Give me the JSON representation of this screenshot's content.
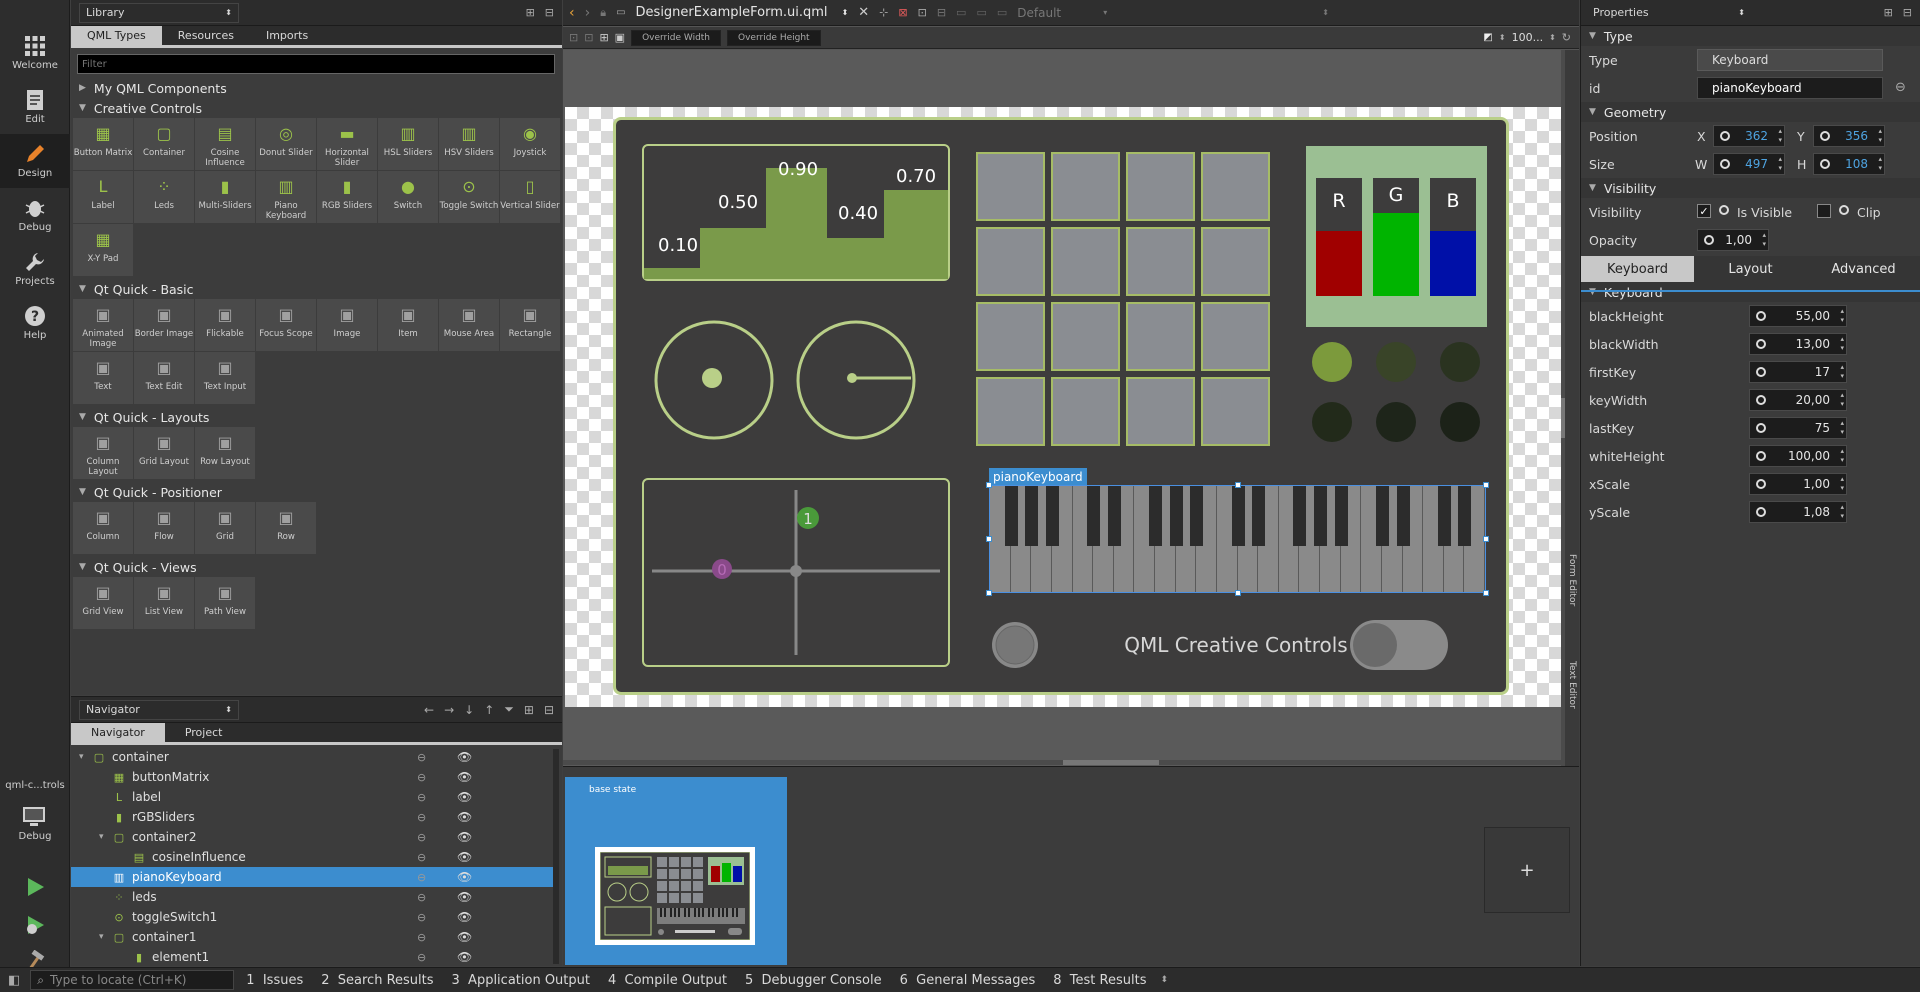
{
  "modes": [
    {
      "label": "Welcome",
      "icon": "grid-icon"
    },
    {
      "label": "Edit",
      "icon": "document-icon"
    },
    {
      "label": "Design",
      "icon": "pen-icon"
    },
    {
      "label": "Debug",
      "icon": "bug-icon"
    },
    {
      "label": "Projects",
      "icon": "wrench-icon"
    },
    {
      "label": "Help",
      "icon": "help-icon"
    }
  ],
  "kit": {
    "label": "qml-c...trols",
    "mode": "Debug"
  },
  "library": {
    "title": "Library",
    "tabs": [
      "QML Types",
      "Resources",
      "Imports"
    ],
    "filter_placeholder": "Filter",
    "sections": [
      {
        "title": "My QML Components",
        "items": []
      },
      {
        "title": "Creative Controls",
        "items": [
          "Button Matrix",
          "Container",
          "Cosine Influence",
          "Donut Slider",
          "Horizontal Slider",
          "HSL Sliders",
          "HSV Sliders",
          "Joystick",
          "Label",
          "Leds",
          "Multi-Sliders",
          "Piano Keyboard",
          "RGB Sliders",
          "Switch",
          "Toggle Switch",
          "Vertical Slider",
          "X-Y Pad"
        ]
      },
      {
        "title": "Qt Quick - Basic",
        "items": [
          "Animated Image",
          "Border Image",
          "Flickable",
          "Focus Scope",
          "Image",
          "Item",
          "Mouse Area",
          "Rectangle",
          "Text",
          "Text Edit",
          "Text Input"
        ]
      },
      {
        "title": "Qt Quick - Layouts",
        "items": [
          "Column Layout",
          "Grid Layout",
          "Row Layout"
        ]
      },
      {
        "title": "Qt Quick - Positioner",
        "items": [
          "Column",
          "Flow",
          "Grid",
          "Row"
        ]
      },
      {
        "title": "Qt Quick - Views",
        "items": [
          "Grid View",
          "List View",
          "Path View"
        ]
      }
    ]
  },
  "navigator": {
    "title": "Navigator",
    "tabs": [
      "Navigator",
      "Project"
    ],
    "rows": [
      {
        "label": "container",
        "depth": 0,
        "expand": "▾",
        "icon": "container-icon"
      },
      {
        "label": "buttonMatrix",
        "depth": 1,
        "expand": "",
        "icon": "button-matrix-icon"
      },
      {
        "label": "label",
        "depth": 1,
        "expand": "",
        "icon": "label-icon"
      },
      {
        "label": "rGBSliders",
        "depth": 1,
        "expand": "",
        "icon": "rgb-sliders-icon"
      },
      {
        "label": "container2",
        "depth": 1,
        "expand": "▾",
        "icon": "container-icon"
      },
      {
        "label": "cosineInfluence",
        "depth": 2,
        "expand": "",
        "icon": "cosine-icon"
      },
      {
        "label": "pianoKeyboard",
        "depth": 1,
        "expand": "",
        "icon": "piano-icon",
        "selected": true
      },
      {
        "label": "leds",
        "depth": 1,
        "expand": "",
        "icon": "leds-icon"
      },
      {
        "label": "toggleSwitch1",
        "depth": 1,
        "expand": "",
        "icon": "toggle-icon"
      },
      {
        "label": "container1",
        "depth": 1,
        "expand": "▾",
        "icon": "container-icon"
      },
      {
        "label": "element1",
        "depth": 2,
        "expand": "",
        "icon": "chart-icon"
      }
    ]
  },
  "editor": {
    "file": "DesignerExampleForm.ui.qml",
    "state_combo": "Default",
    "override_width": "Override Width",
    "override_height": "Override Height",
    "zoom": "100...",
    "selection_label": "pianoKeyboard",
    "slider_values": [
      "0.10",
      "0.50",
      "0.90",
      "0.40",
      "0.70"
    ],
    "rgb_labels": [
      "R",
      "G",
      "B"
    ],
    "rgb_levels": [
      0.55,
      0.7,
      0.55
    ],
    "xy_labels": [
      "1",
      "0"
    ],
    "footer_title": "QML Creative Controls",
    "base_state": "base state",
    "add_state": "+",
    "side_tabs": [
      "Form Editor",
      "Text Editor"
    ]
  },
  "properties": {
    "title": "Properties",
    "type_section": "Type",
    "type_label": "Type",
    "type_value": "Keyboard",
    "id_label": "id",
    "id_value": "pianoKeyboard",
    "geometry_section": "Geometry",
    "position_label": "Position",
    "x_label": "X",
    "x_value": "362",
    "y_label": "Y",
    "y_value": "356",
    "size_label": "Size",
    "w_label": "W",
    "w_value": "497",
    "h_label": "H",
    "h_value": "108",
    "visibility_section": "Visibility",
    "visibility_label": "Visibility",
    "is_visible": "Is Visible",
    "clip": "Clip",
    "opacity_label": "Opacity",
    "opacity_value": "1,00",
    "tabs": [
      "Keyboard",
      "Layout",
      "Advanced"
    ],
    "keyboard_section": "Keyboard",
    "keyboard_props": [
      {
        "name": "blackHeight",
        "value": "55,00"
      },
      {
        "name": "blackWidth",
        "value": "13,00"
      },
      {
        "name": "firstKey",
        "value": "17"
      },
      {
        "name": "keyWidth",
        "value": "20,00"
      },
      {
        "name": "lastKey",
        "value": "75"
      },
      {
        "name": "whiteHeight",
        "value": "100,00"
      },
      {
        "name": "xScale",
        "value": "1,00"
      },
      {
        "name": "yScale",
        "value": "1,08"
      }
    ]
  },
  "bottom": {
    "locate_placeholder": "Type to locate (Ctrl+K)",
    "panes": [
      "1  Issues",
      "2  Search Results",
      "3  Application Output",
      "4  Compile Output",
      "5  Debugger Console",
      "6  General Messages",
      "8  Test Results"
    ]
  },
  "colors": {
    "accent": "#3c8dcf",
    "brand_green": "#9cc24a",
    "panel_border": "#b9cf88"
  }
}
